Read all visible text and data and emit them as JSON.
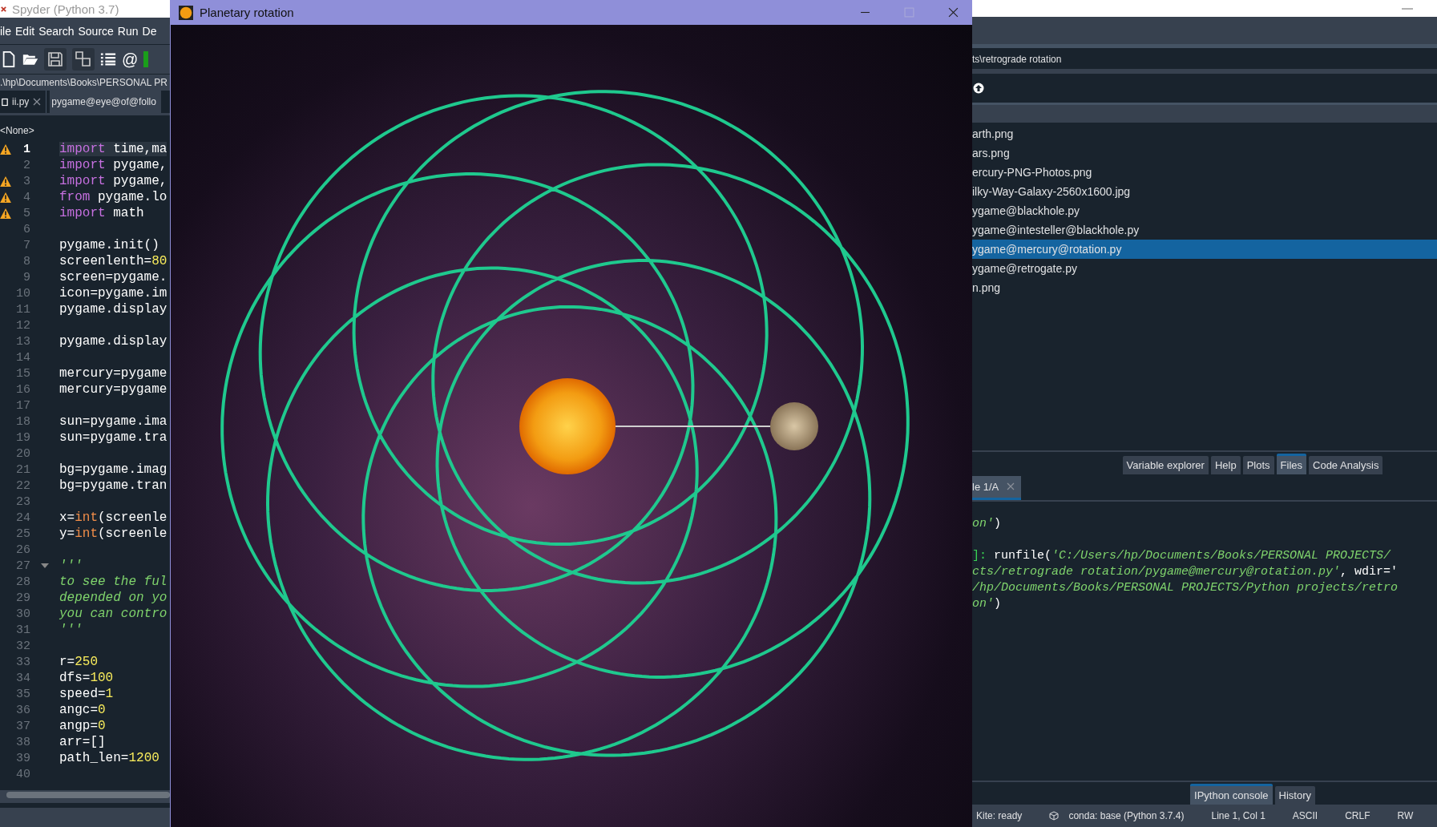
{
  "spyder": {
    "title": "Spyder (Python 3.7)",
    "menu": [
      "ile",
      "Edit",
      "Search",
      "Source",
      "Run",
      "De"
    ],
    "toolbar_at_glyph": "@",
    "path": ".\\hp\\Documents\\Books\\PERSONAL PR",
    "editor_tabs": [
      {
        "label": "ii.py",
        "selected": true,
        "closable": true
      },
      {
        "label": "pygame@eye@of@follo",
        "selected": false,
        "closable": false
      }
    ],
    "outline": "<None>",
    "code": [
      {
        "n": "1",
        "warning": true,
        "current": true,
        "fold": false,
        "tokens": [
          {
            "kind": "keyword",
            "text": "import"
          },
          {
            "kind": "plain",
            "text": " time,ma"
          }
        ]
      },
      {
        "n": "2",
        "warning": false,
        "current": false,
        "fold": false,
        "tokens": [
          {
            "kind": "keyword",
            "text": "import"
          },
          {
            "kind": "plain",
            "text": " pygame,"
          }
        ]
      },
      {
        "n": "3",
        "warning": true,
        "current": false,
        "fold": false,
        "tokens": [
          {
            "kind": "keyword",
            "text": "import"
          },
          {
            "kind": "plain",
            "text": " pygame,"
          }
        ]
      },
      {
        "n": "4",
        "warning": true,
        "current": false,
        "fold": false,
        "tokens": [
          {
            "kind": "keyword",
            "text": "from"
          },
          {
            "kind": "plain",
            "text": " pygame.lo"
          }
        ]
      },
      {
        "n": "5",
        "warning": true,
        "current": false,
        "fold": false,
        "tokens": [
          {
            "kind": "keyword",
            "text": "import"
          },
          {
            "kind": "plain",
            "text": " math"
          }
        ]
      },
      {
        "n": "6",
        "warning": false,
        "current": false,
        "fold": false
      },
      {
        "n": "7",
        "warning": false,
        "current": false,
        "fold": false,
        "tokens": [
          {
            "kind": "plain",
            "text": "pygame.init()"
          }
        ]
      },
      {
        "n": "8",
        "warning": false,
        "current": false,
        "fold": false,
        "tokens": [
          {
            "kind": "plain",
            "text": "screenlenth="
          },
          {
            "kind": "number",
            "text": "80"
          }
        ]
      },
      {
        "n": "9",
        "warning": false,
        "current": false,
        "fold": false,
        "tokens": [
          {
            "kind": "plain",
            "text": "screen=pygame."
          }
        ]
      },
      {
        "n": "10",
        "warning": false,
        "current": false,
        "fold": false,
        "tokens": [
          {
            "kind": "plain",
            "text": "icon=pygame.im"
          }
        ]
      },
      {
        "n": "11",
        "warning": false,
        "current": false,
        "fold": false,
        "tokens": [
          {
            "kind": "plain",
            "text": "pygame.display"
          }
        ]
      },
      {
        "n": "12",
        "warning": false,
        "current": false,
        "fold": false
      },
      {
        "n": "13",
        "warning": false,
        "current": false,
        "fold": false,
        "tokens": [
          {
            "kind": "plain",
            "text": "pygame.display"
          }
        ]
      },
      {
        "n": "14",
        "warning": false,
        "current": false,
        "fold": false
      },
      {
        "n": "15",
        "warning": false,
        "current": false,
        "fold": false,
        "tokens": [
          {
            "kind": "plain",
            "text": "mercury=pygame"
          }
        ]
      },
      {
        "n": "16",
        "warning": false,
        "current": false,
        "fold": false,
        "tokens": [
          {
            "kind": "plain",
            "text": "mercury=pygame"
          }
        ]
      },
      {
        "n": "17",
        "warning": false,
        "current": false,
        "fold": false
      },
      {
        "n": "18",
        "warning": false,
        "current": false,
        "fold": false,
        "tokens": [
          {
            "kind": "plain",
            "text": "sun=pygame.ima"
          }
        ]
      },
      {
        "n": "19",
        "warning": false,
        "current": false,
        "fold": false,
        "tokens": [
          {
            "kind": "plain",
            "text": "sun=pygame.tra"
          }
        ]
      },
      {
        "n": "20",
        "warning": false,
        "current": false,
        "fold": false
      },
      {
        "n": "21",
        "warning": false,
        "current": false,
        "fold": false,
        "tokens": [
          {
            "kind": "plain",
            "text": "bg=pygame.imag"
          }
        ]
      },
      {
        "n": "22",
        "warning": false,
        "current": false,
        "fold": false,
        "tokens": [
          {
            "kind": "plain",
            "text": "bg=pygame.tran"
          }
        ]
      },
      {
        "n": "23",
        "warning": false,
        "current": false,
        "fold": false
      },
      {
        "n": "24",
        "warning": false,
        "current": false,
        "fold": false,
        "tokens": [
          {
            "kind": "plain",
            "text": "x="
          },
          {
            "kind": "builtin",
            "text": "int"
          },
          {
            "kind": "plain",
            "text": "(screenle"
          }
        ]
      },
      {
        "n": "25",
        "warning": false,
        "current": false,
        "fold": false,
        "tokens": [
          {
            "kind": "plain",
            "text": "y="
          },
          {
            "kind": "builtin",
            "text": "int"
          },
          {
            "kind": "plain",
            "text": "(screenle"
          }
        ]
      },
      {
        "n": "26",
        "warning": false,
        "current": false,
        "fold": false
      },
      {
        "n": "27",
        "warning": false,
        "current": false,
        "fold": true,
        "tokens": [
          {
            "kind": "comment",
            "text": "'''"
          }
        ]
      },
      {
        "n": "28",
        "warning": false,
        "current": false,
        "fold": false,
        "tokens": [
          {
            "kind": "comment",
            "text": "to see the ful"
          }
        ]
      },
      {
        "n": "29",
        "warning": false,
        "current": false,
        "fold": false,
        "tokens": [
          {
            "kind": "comment",
            "text": "depended on yo"
          }
        ]
      },
      {
        "n": "30",
        "warning": false,
        "current": false,
        "fold": false,
        "tokens": [
          {
            "kind": "comment",
            "text": "you can contro"
          }
        ]
      },
      {
        "n": "31",
        "warning": false,
        "current": false,
        "fold": false,
        "tokens": [
          {
            "kind": "comment",
            "text": "'''"
          }
        ]
      },
      {
        "n": "32",
        "warning": false,
        "current": false,
        "fold": false
      },
      {
        "n": "33",
        "warning": false,
        "current": false,
        "fold": false,
        "tokens": [
          {
            "kind": "plain",
            "text": "r="
          },
          {
            "kind": "number",
            "text": "250"
          }
        ]
      },
      {
        "n": "34",
        "warning": false,
        "current": false,
        "fold": false,
        "tokens": [
          {
            "kind": "plain",
            "text": "dfs="
          },
          {
            "kind": "number",
            "text": "100"
          }
        ]
      },
      {
        "n": "35",
        "warning": false,
        "current": false,
        "fold": false,
        "tokens": [
          {
            "kind": "plain",
            "text": "speed="
          },
          {
            "kind": "number",
            "text": "1"
          }
        ]
      },
      {
        "n": "36",
        "warning": false,
        "current": false,
        "fold": false,
        "tokens": [
          {
            "kind": "plain",
            "text": "angc="
          },
          {
            "kind": "number",
            "text": "0"
          }
        ]
      },
      {
        "n": "37",
        "warning": false,
        "current": false,
        "fold": false,
        "tokens": [
          {
            "kind": "plain",
            "text": "angp="
          },
          {
            "kind": "number",
            "text": "0"
          }
        ]
      },
      {
        "n": "38",
        "warning": false,
        "current": false,
        "fold": false,
        "tokens": [
          {
            "kind": "plain",
            "text": "arr=[]"
          }
        ]
      },
      {
        "n": "39",
        "warning": false,
        "current": false,
        "fold": false,
        "tokens": [
          {
            "kind": "plain",
            "text": "path_len="
          },
          {
            "kind": "number",
            "text": "1200"
          }
        ]
      },
      {
        "n": "40",
        "warning": false,
        "current": false,
        "fold": false
      }
    ],
    "files_path": "ts\\retrograde rotation",
    "files": [
      {
        "name": "arth.png",
        "selected": false
      },
      {
        "name": "ars.png",
        "selected": false
      },
      {
        "name": "ercury-PNG-Photos.png",
        "selected": false
      },
      {
        "name": "ilky-Way-Galaxy-2560x1600.jpg",
        "selected": false
      },
      {
        "name": "ygame@blackhole.py",
        "selected": false
      },
      {
        "name": "ygame@intesteller@blackhole.py",
        "selected": false
      },
      {
        "name": "ygame@mercury@rotation.py",
        "selected": true
      },
      {
        "name": "ygame@retrogate.py",
        "selected": false
      },
      {
        "name": "n.png",
        "selected": false
      }
    ],
    "pane_tabs": [
      {
        "label": "Variable explorer",
        "selected": false
      },
      {
        "label": "Help",
        "selected": false
      },
      {
        "label": "Plots",
        "selected": false
      },
      {
        "label": "Files",
        "selected": true
      },
      {
        "label": "Code Analysis",
        "selected": false
      }
    ],
    "console_tab": "le 1/A",
    "console_blocks": [
      [
        [
          {
            "kind": "string",
            "text": "on'"
          },
          {
            "kind": "plain",
            "text": ")"
          }
        ]
      ],
      [
        [
          {
            "kind": "prompt",
            "text": "]:"
          },
          {
            "kind": "plain",
            "text": " runfile("
          },
          {
            "kind": "string",
            "text": "'C:/Users/hp/Documents/Books/PERSONAL PROJECTS/"
          }
        ],
        [
          {
            "kind": "string",
            "text": "cts/retrograde rotation/pygame@mercury@rotation.py'"
          },
          {
            "kind": "plain",
            "text": ", wdir='"
          }
        ],
        [
          {
            "kind": "string",
            "text": "/hp/Documents/Books/PERSONAL PROJECTS/Python projects/retro"
          }
        ],
        [
          {
            "kind": "string",
            "text": "on'"
          },
          {
            "kind": "plain",
            "text": ")"
          }
        ]
      ]
    ],
    "console_tabs": [
      {
        "label": "IPython console",
        "selected": true
      },
      {
        "label": "History",
        "selected": false
      }
    ],
    "status": {
      "kite": "Kite: ready",
      "conda": "conda: base (Python 3.7.4)",
      "position": "Line 1, Col 1",
      "encoding": "ASCII",
      "eol": "CRLF",
      "mode": "RW"
    }
  },
  "game_window": {
    "title": "Planetary rotation"
  }
}
